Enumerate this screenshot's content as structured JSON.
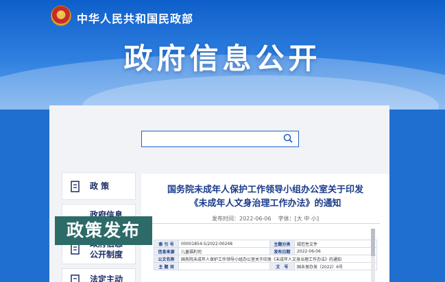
{
  "header": {
    "site_name": "中华人民共和国民政部",
    "hero_title": "政府信息公开"
  },
  "search": {
    "value": "",
    "placeholder": ""
  },
  "sidebar": {
    "items": [
      {
        "label": "政 策"
      },
      {
        "label": "政府信息"
      },
      {
        "label": "政府信息公开制度",
        "line1": "政府信息",
        "line2": "公开制度"
      },
      {
        "label": "法定主动"
      }
    ]
  },
  "document": {
    "title_line1": "国务院未成年人保护工作领导小组办公室关于印发",
    "title_line2": "《未成年人文身治理工作办法》的通知",
    "publish_label": "发布时间：2022-06-06",
    "font_size_label": "字体：[大 中 小]",
    "table": {
      "r1": {
        "l1": "索 引 号",
        "v1": "00001854-5/2022-00248",
        "l2": "主题分类",
        "v2": "规范性文件"
      },
      "r2": {
        "l1": "信息来源",
        "v1": "儿童福利司",
        "l2": "发布日期",
        "v2": "2022-06-06"
      },
      "r3": {
        "l1": "公文名称",
        "v1": "国务院未成年人保护工作领导小组办公室关于印发《未成年人文身治理工作办法》的通知"
      },
      "r4": {
        "l1": "主 题 词",
        "v1": "",
        "l2": "文　号",
        "v2": "国未保办发〔2022〕6号"
      }
    }
  },
  "caption": "政策发布",
  "colors": {
    "banner_blue": "#1f6fd0",
    "title_navy": "#1a3b8a",
    "caption_teal": "#2d6b68"
  }
}
